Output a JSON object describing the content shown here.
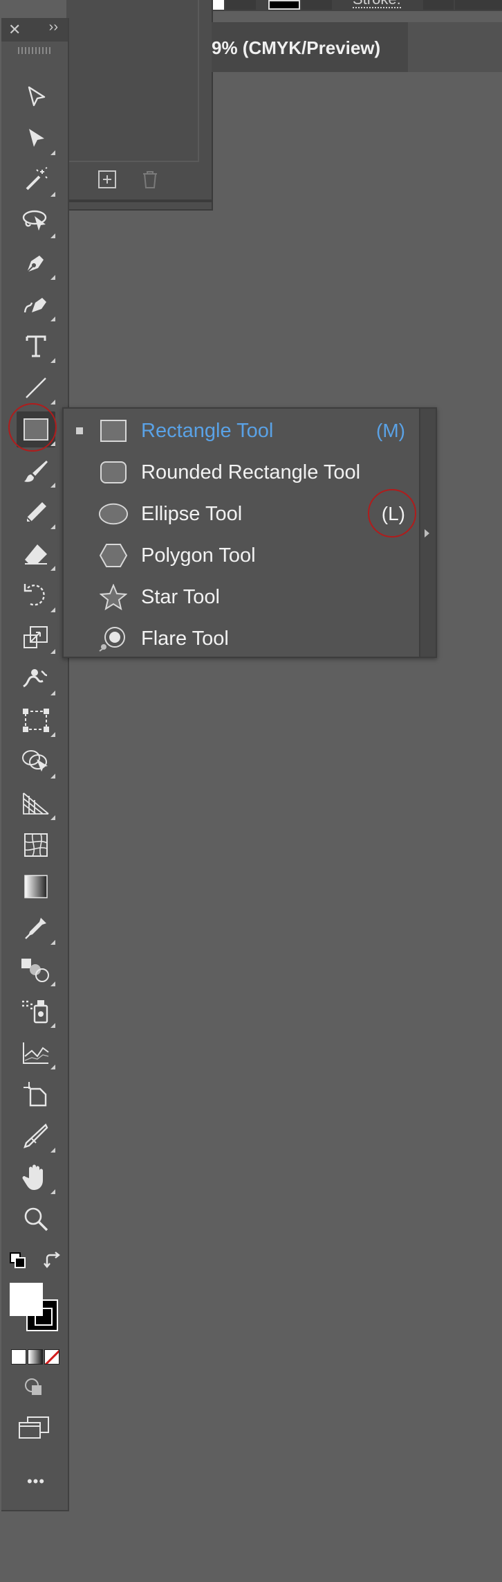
{
  "document": {
    "tab_title": "9% (CMYK/Preview)",
    "stroke_label": "Stroke:"
  },
  "toolbar": {
    "close_glyph": "✕",
    "collapse_glyph": "››",
    "more_glyph": "•••",
    "tools": [
      {
        "name": "direct-selection-tool"
      },
      {
        "name": "selection-tool"
      },
      {
        "name": "magic-wand-tool"
      },
      {
        "name": "lasso-tool"
      },
      {
        "name": "pen-tool"
      },
      {
        "name": "curvature-tool"
      },
      {
        "name": "type-tool"
      },
      {
        "name": "line-segment-tool"
      },
      {
        "name": "rectangle-tool"
      },
      {
        "name": "paintbrush-tool"
      },
      {
        "name": "pencil-tool"
      },
      {
        "name": "eraser-tool"
      },
      {
        "name": "rotate-tool"
      },
      {
        "name": "scale-tool"
      },
      {
        "name": "warp-tool"
      },
      {
        "name": "free-transform-tool"
      },
      {
        "name": "shape-builder-tool"
      },
      {
        "name": "perspective-grid-tool"
      },
      {
        "name": "mesh-tool"
      },
      {
        "name": "gradient-tool"
      },
      {
        "name": "eyedropper-tool"
      },
      {
        "name": "blend-tool"
      },
      {
        "name": "symbol-sprayer-tool"
      },
      {
        "name": "column-graph-tool"
      },
      {
        "name": "artboard-tool"
      },
      {
        "name": "slice-tool"
      },
      {
        "name": "hand-tool"
      },
      {
        "name": "zoom-tool"
      }
    ]
  },
  "flyout": {
    "items": [
      {
        "label": "Rectangle Tool",
        "shortcut": "(M)",
        "selected": true,
        "icon": "rectangle-icon"
      },
      {
        "label": "Rounded Rectangle Tool",
        "shortcut": "",
        "selected": false,
        "icon": "rounded-rectangle-icon"
      },
      {
        "label": "Ellipse Tool",
        "shortcut": "(L)",
        "selected": false,
        "icon": "ellipse-icon"
      },
      {
        "label": "Polygon Tool",
        "shortcut": "",
        "selected": false,
        "icon": "polygon-icon"
      },
      {
        "label": "Star Tool",
        "shortcut": "",
        "selected": false,
        "icon": "star-icon"
      },
      {
        "label": "Flare Tool",
        "shortcut": "",
        "selected": false,
        "icon": "flare-icon"
      }
    ]
  },
  "colors": {
    "selected_text": "#5aa2e6",
    "highlight_ring": "#b01c1c",
    "fill_swatch": "#ffffff",
    "stroke_swatch": "#000000"
  }
}
